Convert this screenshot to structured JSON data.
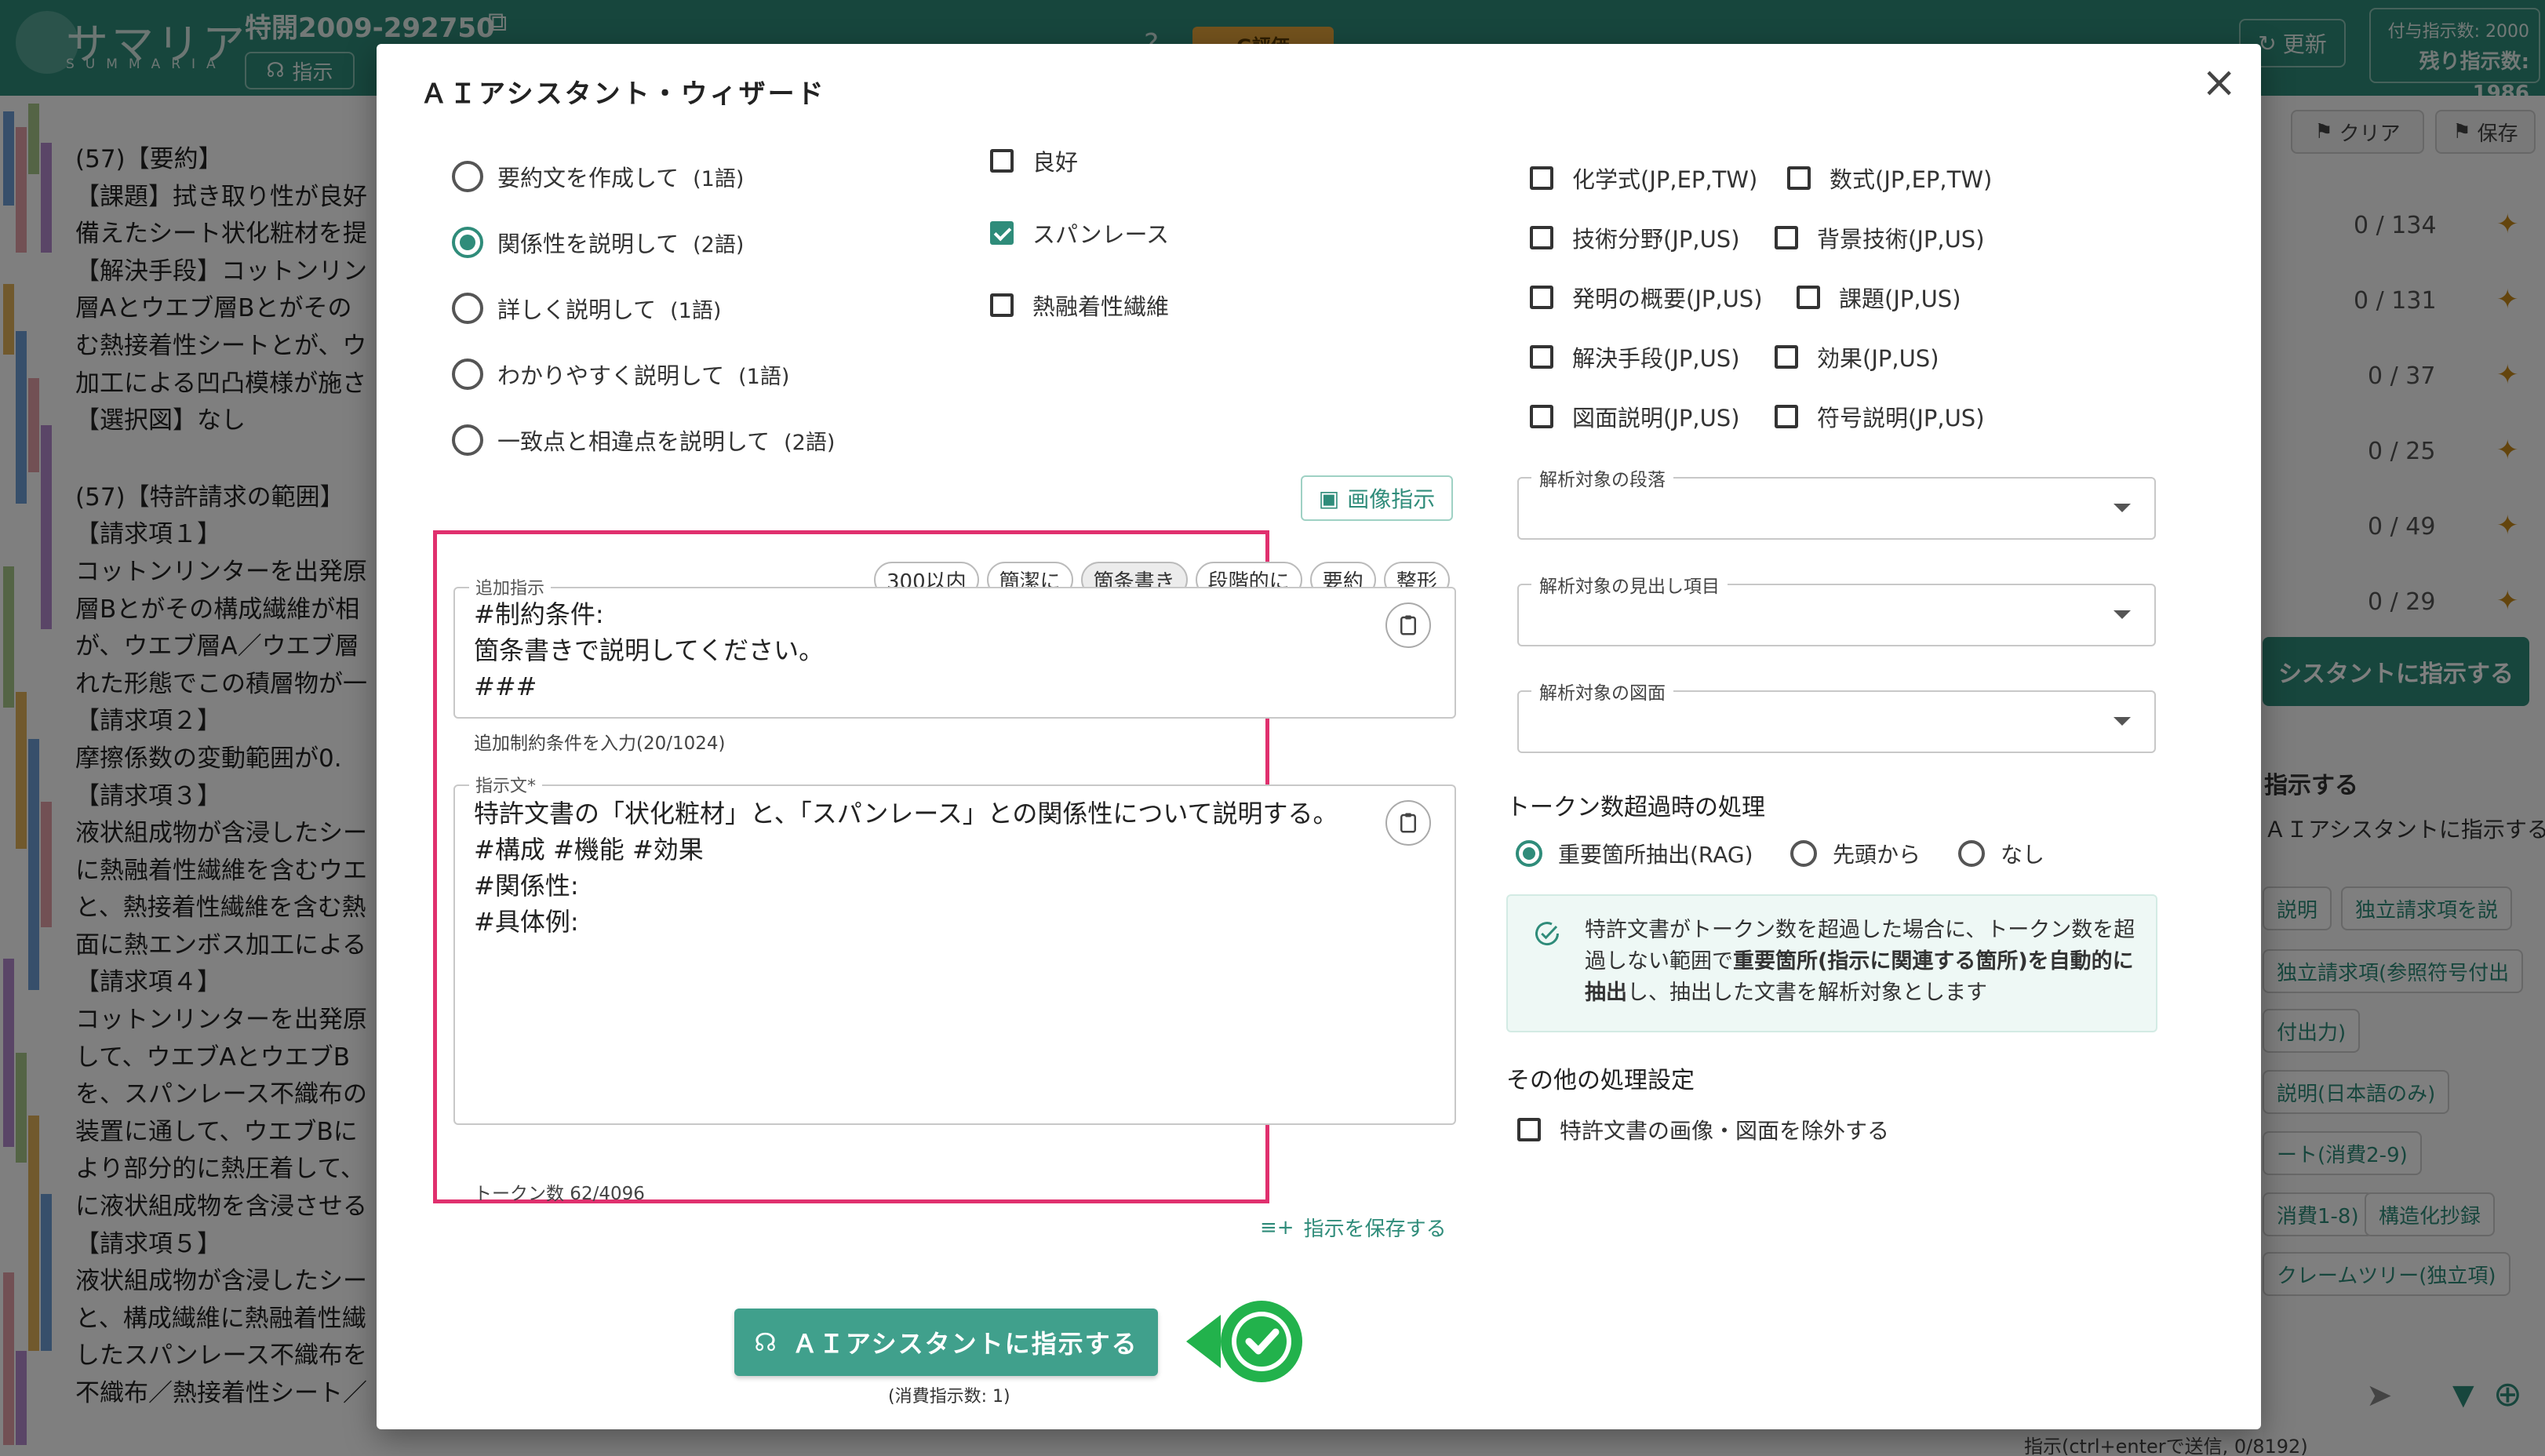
{
  "app": {
    "logo_text": "サマリア",
    "logo_sub": "SUMMARIA",
    "patent_id": "特開2009-292750",
    "instruct_label": "指示",
    "eval_label": "G評価",
    "update_label": "更新",
    "granted_label": "付与指示数: 2000",
    "remaining_label": "残り指示数: 1986"
  },
  "document": {
    "summary_lines": [
      "(57)【要約】",
      "【課題】拭き取り性が良好",
      "備えたシート状化粧材を提",
      "【解決手段】コットンリン",
      "層Aとウエブ層Bとがその",
      "む熱接着性シートとが、ウ",
      "加工による凹凸模様が施さ",
      "【選択図】なし"
    ],
    "claims_lines": [
      "(57)【特許請求の範囲】",
      "【請求項１】",
      "コットンリンターを出発原",
      "層Bとがその構成繊維が相",
      "が、ウエブ層A／ウエブ層",
      "れた形態でこの積層物が一",
      "【請求項２】",
      "摩擦係数の変動範囲が0.",
      "【請求項３】",
      "液状組成物が含浸したシー",
      "に熱融着性繊維を含むウエ",
      "と、熱接着性繊維を含む熱",
      "面に熱エンボス加工による",
      "【請求項４】",
      "コットンリンターを出発原",
      "して、ウエブAとウエブB",
      "を、スパンレース不織布の",
      "装置に通して、ウエブBに",
      "より部分的に熱圧着して、",
      "に液状組成物を含浸させる",
      "【請求項５】",
      "液状組成物が含浸したシー",
      "と、構成繊維に熱融着性繊",
      "したスパンレース不織布を",
      "不織布／熱接着性シート／"
    ]
  },
  "right_panel": {
    "clear_label": "クリア",
    "save_label": "保存",
    "counts": [
      "0 / 134",
      "0 / 131",
      "0 / 37",
      "0 / 25",
      "0 / 49",
      "0 / 29"
    ],
    "assist_button": "シスタントに指示する",
    "section_heading": "指示する",
    "section_sub": "ＡＩアシスタントに指示する",
    "chips": [
      "説明",
      "独立請求項を説",
      "独立請求項(参照符号付出",
      "付出力)",
      "説明(日本語のみ)",
      "ート(消費2-9)",
      "消費1-8)",
      "構造化抄録",
      "クレームツリー(独立項)"
    ],
    "footer": "指示(ctrl+enterで送信, 0/8192)"
  },
  "modal": {
    "title": "ＡＩアシスタント・ウィザード",
    "close_label": "×",
    "radios": [
      {
        "label": "要約文を作成して",
        "note": "(1語)",
        "selected": false
      },
      {
        "label": "関係性を説明して",
        "note": "(2語)",
        "selected": true
      },
      {
        "label": "詳しく説明して",
        "note": "(1語)",
        "selected": false
      },
      {
        "label": "わかりやすく説明して",
        "note": "(1語)",
        "selected": false
      },
      {
        "label": "一致点と相違点を説明して",
        "note": "(2語)",
        "selected": false
      }
    ],
    "keywords": [
      {
        "label": "良好",
        "checked": false
      },
      {
        "label": "スパンレース",
        "checked": true
      },
      {
        "label": "熱融着性繊維",
        "checked": false
      }
    ],
    "sections": [
      {
        "label": "化学式(JP,EP,TW)",
        "checked": false
      },
      {
        "label": "数式(JP,EP,TW)",
        "checked": false
      },
      {
        "label": "技術分野(JP,US)",
        "checked": false
      },
      {
        "label": "背景技術(JP,US)",
        "checked": false
      },
      {
        "label": "発明の概要(JP,US)",
        "checked": false
      },
      {
        "label": "課題(JP,US)",
        "checked": false
      },
      {
        "label": "解決手段(JP,US)",
        "checked": false
      },
      {
        "label": "効果(JP,US)",
        "checked": false
      },
      {
        "label": "図面説明(JP,US)",
        "checked": false
      },
      {
        "label": "符号説明(JP,US)",
        "checked": false
      }
    ],
    "image_instruction_label": "画像指示",
    "chips": [
      {
        "label": "300以内",
        "active": false
      },
      {
        "label": "簡潔に",
        "active": false
      },
      {
        "label": "箇条書き",
        "active": true
      },
      {
        "label": "段階的に",
        "active": false
      },
      {
        "label": "要約",
        "active": false
      },
      {
        "label": "整形",
        "active": false
      }
    ],
    "additional": {
      "label": "追加指示",
      "value": "#制約条件:\n箇条書きで説明してください。\n###",
      "helper": "追加制約条件を入力(20/1024)"
    },
    "prompt": {
      "label": "指示文*",
      "value": "特許文書の「状化粧材」と、「スパンレース」との関係性について説明する。\n#構成 #機能 #効果\n#関係性:\n#具体例:",
      "helper": "トークン数 62/4096"
    },
    "save_instruction_label": "指示を保存する",
    "submit_label": "ＡＩアシスタントに指示する",
    "consumption": "(消費指示数: 1)",
    "selects": [
      {
        "label": "解析対象の段落",
        "value": ""
      },
      {
        "label": "解析対象の見出し項目",
        "value": ""
      },
      {
        "label": "解析対象の図面",
        "value": ""
      }
    ],
    "token_section": {
      "title": "トークン数超過時の処理",
      "options": [
        {
          "label": "重要箇所抽出(RAG)",
          "selected": true
        },
        {
          "label": "先頭から",
          "selected": false
        },
        {
          "label": "なし",
          "selected": false
        }
      ],
      "info_pre": "特許文書がトークン数を超過した場合に、トークン数を超過しない範囲で",
      "info_bold": "重要箇所(指示に関連する箇所)を自動的に抽出",
      "info_post": "し、抽出した文書を解析対象とします"
    },
    "other_section": {
      "title": "その他の処理設定",
      "option_label": "特許文書の画像・図面を除外する",
      "checked": false
    }
  },
  "colors": {
    "accent": "#2f8c7a",
    "highlight_border": "#e0306e",
    "header": "#2f8c7a",
    "success": "#22b24c"
  }
}
